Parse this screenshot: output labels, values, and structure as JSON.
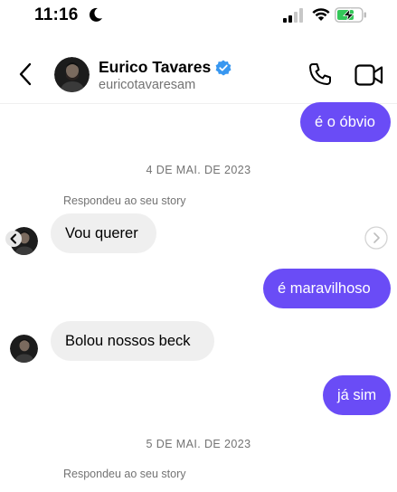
{
  "status_bar": {
    "time": "11:16"
  },
  "header": {
    "name": "Eurico Tavares",
    "username": "euricotavaresam"
  },
  "messages": {
    "m1": "é o óbvio",
    "date1": "4 DE MAI. DE 2023",
    "story_reply1": "Respondeu ao seu story",
    "m2": "Vou querer",
    "m3": "é maravilhoso",
    "m4": "Bolou nossos beck",
    "m5": "já sim",
    "date2": "5 DE MAI. DE 2023",
    "story_reply2": "Respondeu ao seu story"
  },
  "colors": {
    "sent_bubble": "#6a4cf6",
    "received_bubble": "#efefef",
    "verified": "#3897f0",
    "battery_charge": "#34c759"
  }
}
